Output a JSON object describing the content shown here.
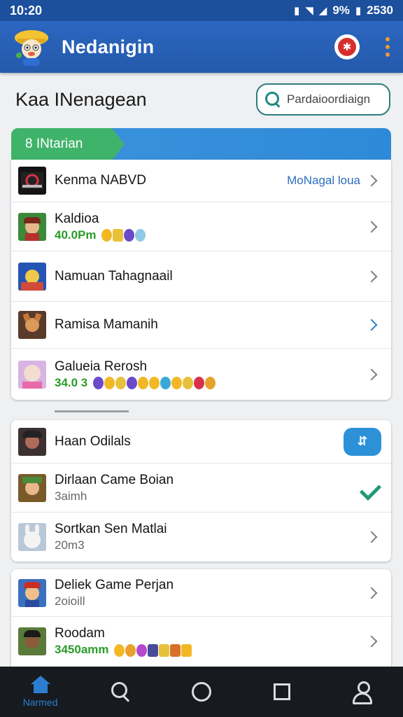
{
  "status_bar": {
    "time": "10:20",
    "battery": "9%",
    "clock_right": "2530"
  },
  "app_bar": {
    "title": "Nedanigin"
  },
  "page": {
    "title": "Kaa INenagean",
    "search_placeholder": "Pardaioordiaign"
  },
  "banner": {
    "label": "8 INtarian"
  },
  "section1": {
    "rows": [
      {
        "name": "Kenma NABVD",
        "link": "MoNagal loua",
        "thumb": "#1a1a1a"
      },
      {
        "name": "Kaldioa",
        "sub": "40.0Pm",
        "thumb": "#3a8a3a"
      },
      {
        "name": "Namuan Tahagnaail",
        "thumb": "#2455b5"
      },
      {
        "name": "Ramisa Mamanih",
        "thumb": "#8a5a3a"
      },
      {
        "name": "Galueia Rerosh",
        "sub": "34.0 3",
        "thumb": "#c9a9d9"
      }
    ]
  },
  "section2": {
    "rows": [
      {
        "name": "Haan Odilals",
        "thumb": "#3d3030"
      },
      {
        "name": "Dirlaan Came Boian",
        "sub": "3aimh",
        "thumb": "#7a5a2a"
      },
      {
        "name": "Sortkan Sen Matlai",
        "sub": "20m3",
        "thumb": "#c8d4e0"
      }
    ]
  },
  "section3": {
    "rows": [
      {
        "name": "Deliek Game Perjan",
        "sub": "2oioill",
        "thumb": "#3a70c0"
      },
      {
        "name": "Roodam",
        "sub": "3450amm",
        "thumb": "#4a6a2a"
      }
    ]
  },
  "bottom_nav": {
    "home_label": "Narmed"
  },
  "icons": [
    "app-logo-icon",
    "alert-icon",
    "more-icon",
    "search-icon",
    "chevron-right-icon",
    "checkmark-icon",
    "sort-icon",
    "home-icon",
    "search-nav-icon",
    "circle-nav-icon",
    "square-nav-icon",
    "profile-icon"
  ],
  "colors": {
    "app_bar": "#2b66c0",
    "banner_tag": "#40b36a",
    "banner": "#3c93dc",
    "accent": "#2c7fd0",
    "positive": "#2a9d2a",
    "check": "#1f9a78"
  }
}
